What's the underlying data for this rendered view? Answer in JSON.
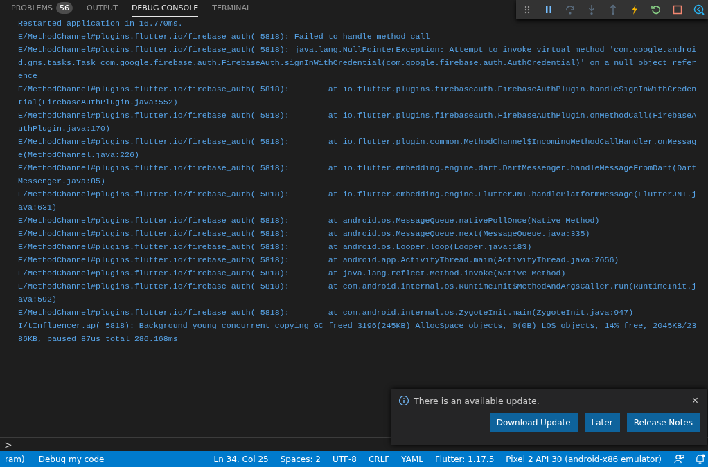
{
  "panel_tabs": [
    {
      "label": "PROBLEMS",
      "badge": "56",
      "selected": false
    },
    {
      "label": "OUTPUT",
      "selected": false
    },
    {
      "label": "DEBUG CONSOLE",
      "selected": true
    },
    {
      "label": "TERMINAL",
      "selected": false
    }
  ],
  "debug_toolbar": [
    {
      "kind": "grip",
      "disabled": false
    },
    {
      "kind": "pause",
      "disabled": false
    },
    {
      "kind": "step-over",
      "disabled": true
    },
    {
      "kind": "step-into",
      "disabled": true
    },
    {
      "kind": "step-out",
      "disabled": true
    },
    {
      "kind": "hot-reload",
      "disabled": false
    },
    {
      "kind": "restart",
      "disabled": false
    },
    {
      "kind": "stop",
      "disabled": false
    },
    {
      "kind": "devtools",
      "disabled": false
    }
  ],
  "console_lines": [
    "Restarted application in 16.770ms.",
    "E/MethodChannel#plugins.flutter.io/firebase_auth( 5818): Failed to handle method call",
    "E/MethodChannel#plugins.flutter.io/firebase_auth( 5818): java.lang.NullPointerException: Attempt to invoke virtual method 'com.google.android.gms.tasks.Task com.google.firebase.auth.FirebaseAuth.signInWithCredential(com.google.firebase.auth.AuthCredential)' on a null object reference",
    "E/MethodChannel#plugins.flutter.io/firebase_auth( 5818):        at io.flutter.plugins.firebaseauth.FirebaseAuthPlugin.handleSignInWithCredential(FirebaseAuthPlugin.java:552)",
    "E/MethodChannel#plugins.flutter.io/firebase_auth( 5818):        at io.flutter.plugins.firebaseauth.FirebaseAuthPlugin.onMethodCall(FirebaseAuthPlugin.java:170)",
    "E/MethodChannel#plugins.flutter.io/firebase_auth( 5818):        at io.flutter.plugin.common.MethodChannel$IncomingMethodCallHandler.onMessage(MethodChannel.java:226)",
    "E/MethodChannel#plugins.flutter.io/firebase_auth( 5818):        at io.flutter.embedding.engine.dart.DartMessenger.handleMessageFromDart(DartMessenger.java:85)",
    "E/MethodChannel#plugins.flutter.io/firebase_auth( 5818):        at io.flutter.embedding.engine.FlutterJNI.handlePlatformMessage(FlutterJNI.java:631)",
    "E/MethodChannel#plugins.flutter.io/firebase_auth( 5818):        at android.os.MessageQueue.nativePollOnce(Native Method)",
    "E/MethodChannel#plugins.flutter.io/firebase_auth( 5818):        at android.os.MessageQueue.next(MessageQueue.java:335)",
    "E/MethodChannel#plugins.flutter.io/firebase_auth( 5818):        at android.os.Looper.loop(Looper.java:183)",
    "E/MethodChannel#plugins.flutter.io/firebase_auth( 5818):        at android.app.ActivityThread.main(ActivityThread.java:7656)",
    "E/MethodChannel#plugins.flutter.io/firebase_auth( 5818):        at java.lang.reflect.Method.invoke(Native Method)",
    "E/MethodChannel#plugins.flutter.io/firebase_auth( 5818):        at com.android.internal.os.RuntimeInit$MethodAndArgsCaller.run(RuntimeInit.java:592)",
    "E/MethodChannel#plugins.flutter.io/firebase_auth( 5818):        at com.android.internal.os.ZygoteInit.main(ZygoteInit.java:947)",
    "I/tInfluencer.ap( 5818): Background young concurrent copying GC freed 3196(245KB) AllocSpace objects, 0(0B) LOS objects, 14% free, 2045KB/2386KB, paused 87us total 286.168ms"
  ],
  "console_input": {
    "prompt": ">"
  },
  "notification": {
    "message": "There is an available update.",
    "close": "×",
    "buttons": [
      "Download Update",
      "Later",
      "Release Notes"
    ]
  },
  "status_bar": {
    "left": [
      "ram)",
      "Debug my code"
    ],
    "right": [
      "Ln 34, Col 25",
      "Spaces: 2",
      "UTF-8",
      "CRLF",
      "YAML",
      "Flutter: 1.17.5",
      "Pixel 2 API 30 (android-x86 emulator)"
    ]
  }
}
